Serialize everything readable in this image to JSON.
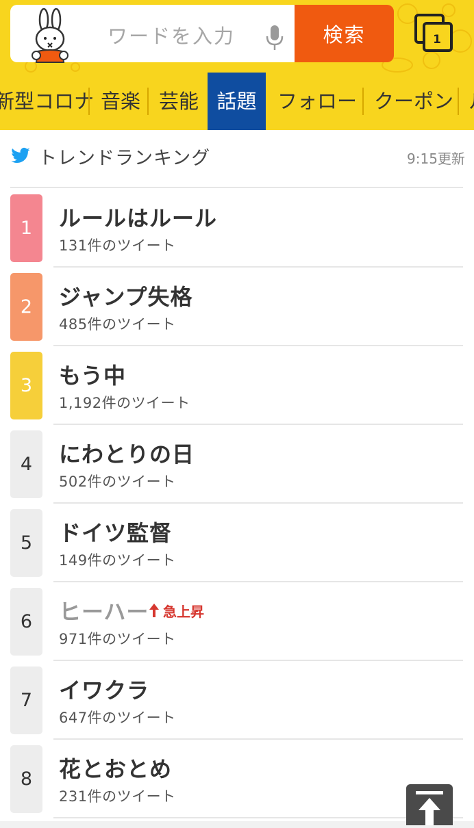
{
  "search": {
    "placeholder": "ワードを入力",
    "button_label": "検索",
    "tab_count": "1"
  },
  "nav": {
    "items": [
      "新型コロナ",
      "音楽",
      "芸能",
      "話題",
      "フォロー",
      "クーポン",
      "ル"
    ],
    "active": "話題"
  },
  "trend": {
    "title": "トレンドランキング",
    "updated": "9:15更新",
    "items": [
      {
        "rank": "1",
        "title": "ルールはルール",
        "count": "131件のツイート"
      },
      {
        "rank": "2",
        "title": "ジャンプ失格",
        "count": "485件のツイート"
      },
      {
        "rank": "3",
        "title": "もう中",
        "count": "1,192件のツイート"
      },
      {
        "rank": "4",
        "title": "にわとりの日",
        "count": "502件のツイート"
      },
      {
        "rank": "5",
        "title": "ドイツ監督",
        "count": "149件のツイート"
      },
      {
        "rank": "6",
        "title": "ヒーハー",
        "count": "971件のツイート",
        "badge": "急上昇"
      },
      {
        "rank": "7",
        "title": "イワクラ",
        "count": "647件のツイート"
      },
      {
        "rank": "8",
        "title": "花とおとめ",
        "count": "231件のツイート"
      }
    ]
  },
  "colors": {
    "header_yellow": "#f8d51e",
    "search_orange": "#f05a10",
    "nav_active_blue": "#0f4da0",
    "rank1": "#f48690",
    "rank2": "#f6976a",
    "rank3": "#f6cf3a",
    "rising_red": "#d6372f"
  },
  "icons": [
    "miffy-logo",
    "microphone-icon",
    "browser-tabs-icon",
    "twitter-bird-icon",
    "rising-arrow-icon",
    "scroll-to-top-icon"
  ]
}
